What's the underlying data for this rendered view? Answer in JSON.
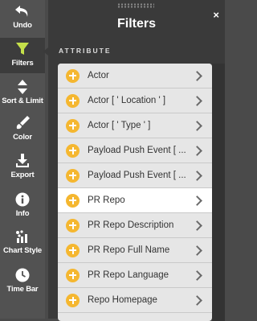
{
  "sidebar": {
    "items": [
      {
        "label": "Undo",
        "icon": "undo-icon"
      },
      {
        "label": "Filters",
        "icon": "funnel-icon",
        "active": true,
        "accent": "#c5e04a"
      },
      {
        "label": "Sort & Limit",
        "icon": "sort-icon"
      },
      {
        "label": "Color",
        "icon": "paint-icon"
      },
      {
        "label": "Export",
        "icon": "download-icon"
      },
      {
        "label": "Info",
        "icon": "info-icon"
      },
      {
        "label": "Chart Style",
        "icon": "chart-style-icon"
      },
      {
        "label": "Time Bar",
        "icon": "clock-icon"
      }
    ]
  },
  "panel": {
    "title": "Filters",
    "close": "×",
    "section_label": "ATTRIBUTE",
    "attributes": [
      {
        "label": "Actor"
      },
      {
        "label": "Actor [ ' Location ' ]"
      },
      {
        "label": "Actor [ ' Type ' ]"
      },
      {
        "label": "Payload Push Event [ ..."
      },
      {
        "label": "Payload Push Event [ ..."
      },
      {
        "label": "PR Repo",
        "selected": true
      },
      {
        "label": "PR Repo Description"
      },
      {
        "label": "PR Repo Full Name"
      },
      {
        "label": "PR Repo Language"
      },
      {
        "label": "Repo Homepage"
      }
    ]
  },
  "colors": {
    "add_button": "#f5b730",
    "active_icon": "#c5e04a"
  }
}
